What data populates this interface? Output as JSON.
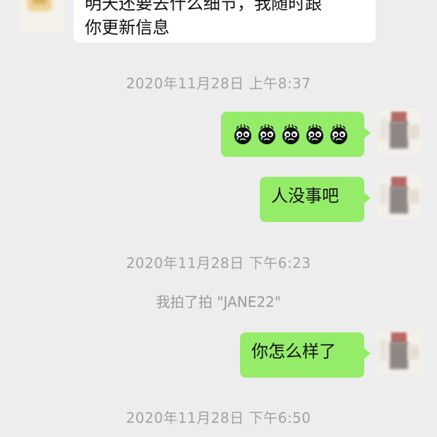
{
  "incoming": {
    "line1": "明天还要去什么细节，我随时跟",
    "line2": "你更新信息"
  },
  "timestamps": {
    "t1": "2020年11月28日 上午8:37",
    "t2": "2020年11月28日 下午6:23",
    "t3": "2020年11月28日 下午6:50"
  },
  "messages": {
    "emoji_message": {
      "icon": "crying-face-emoji",
      "count": 5
    },
    "m2": "人没事吧",
    "m3": "你怎么样了"
  },
  "system": {
    "pat": "我拍了拍 \"JANE22\""
  },
  "colors": {
    "background": "#ededed",
    "outgoing_bubble": "#95ec69",
    "incoming_bubble": "#ffffff",
    "timestamp_text": "#a3a3a3"
  }
}
